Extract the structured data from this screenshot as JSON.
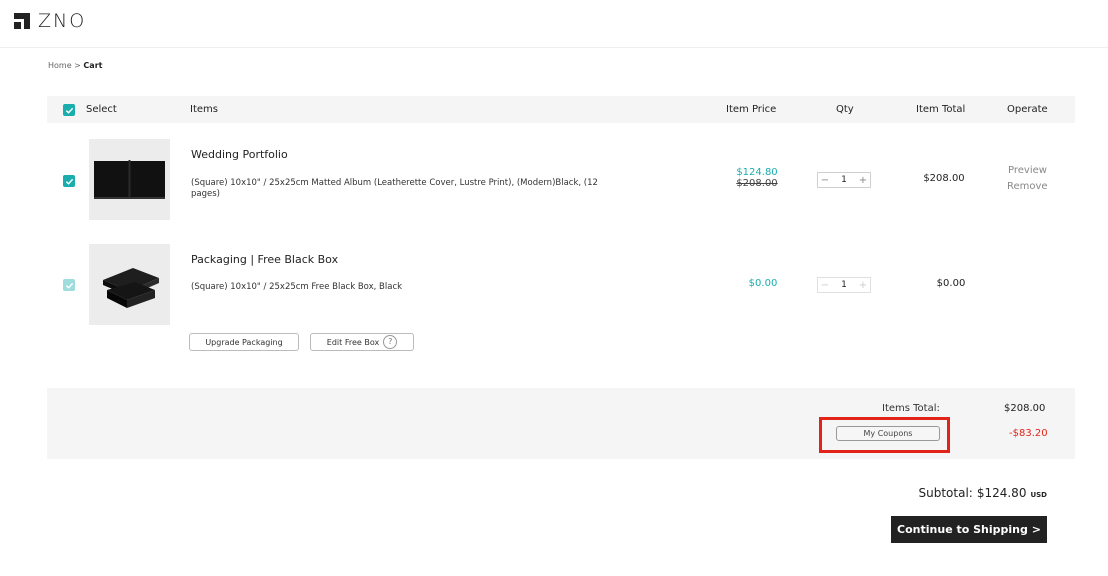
{
  "brand": {
    "logo_text": "ZNO"
  },
  "breadcrumb": {
    "home": "Home",
    "sep": " > ",
    "current": "Cart"
  },
  "table": {
    "headers": {
      "select": "Select",
      "items": "Items",
      "price": "Item Price",
      "qty": "Qty",
      "total": "Item Total",
      "operate": "Operate"
    }
  },
  "items": [
    {
      "name": "Wedding Portfolio",
      "desc": "(Square) 10x10\" / 25x25cm Matted Album (Leatherette Cover, Lustre Print), (Modern)Black, (12 pages)",
      "sale_price": "$124.80",
      "orig_price": "$208.00",
      "qty": "1",
      "total": "$208.00",
      "preview": "Preview",
      "remove": "Remove"
    },
    {
      "name": "Packaging | Free Black Box",
      "desc": "(Square) 10x10\" / 25x25cm Free Black Box, Black",
      "sale_price": "$0.00",
      "qty": "1",
      "total": "$0.00",
      "upgrade_label": "Upgrade Packaging",
      "edit_label": "Edit Free Box",
      "help_symbol": "?"
    }
  ],
  "summary": {
    "items_total_label": "Items Total:",
    "items_total_value": "$208.00",
    "coupon_label": "My Coupons",
    "discount_value": "-$83.20"
  },
  "subtotal": {
    "label": "Subtotal:",
    "amount": "$124.80",
    "currency": "USD"
  },
  "continue_label": "Continue to Shipping >",
  "colors": {
    "accent": "#1aadad",
    "discount": "#e2231a",
    "dark_button": "#222222",
    "highlight": "#e2231a"
  }
}
